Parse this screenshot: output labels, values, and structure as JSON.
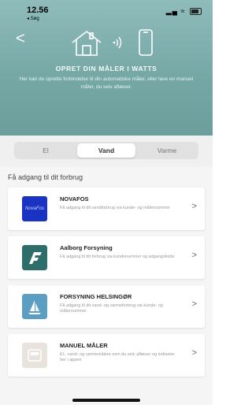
{
  "status_bar": {
    "time": "12.56",
    "back_app": "◂ Søg"
  },
  "header": {
    "back_label": "<",
    "title": "OPRET DIN MÅLER I WATTS",
    "subtitle": "Her kan du oprette forbindelse til din automatiske måler, eller lave en manuel måler, du selv aflæser."
  },
  "tabs": [
    {
      "label": "El",
      "active": false
    },
    {
      "label": "Vand",
      "active": true
    },
    {
      "label": "Varme",
      "active": false
    }
  ],
  "section_title": "Få adgang til dit forbrug",
  "providers": [
    {
      "title": "NOVAFOS",
      "desc": "Få adgang til dit vandforbrug via kunde- og målernummer",
      "logo_color": "#1a33c2",
      "logo_text": "NovaFos"
    },
    {
      "title": "Aalborg Forsyning",
      "desc": "Få adgang til dit forbrug via kundenummer og adgangskode",
      "logo_color": "#2d6e6a",
      "logo_text": ""
    },
    {
      "title": "FORSYNING HELSINGØR",
      "desc": "Få adgang til dit vand- og varmeforbrug via kunde- og målernummer",
      "logo_color": "#5c9ec2",
      "logo_text": ""
    },
    {
      "title": "MANUEL MÅLER",
      "desc": "El-, vand- og varmemålere som du selv aflæser og indtaster her i appen",
      "logo_color": "#e9e3dd",
      "logo_text": ""
    }
  ],
  "chevron": ">",
  "colors": {
    "header": "#76a8a6",
    "accent_white": "#ffffff"
  }
}
